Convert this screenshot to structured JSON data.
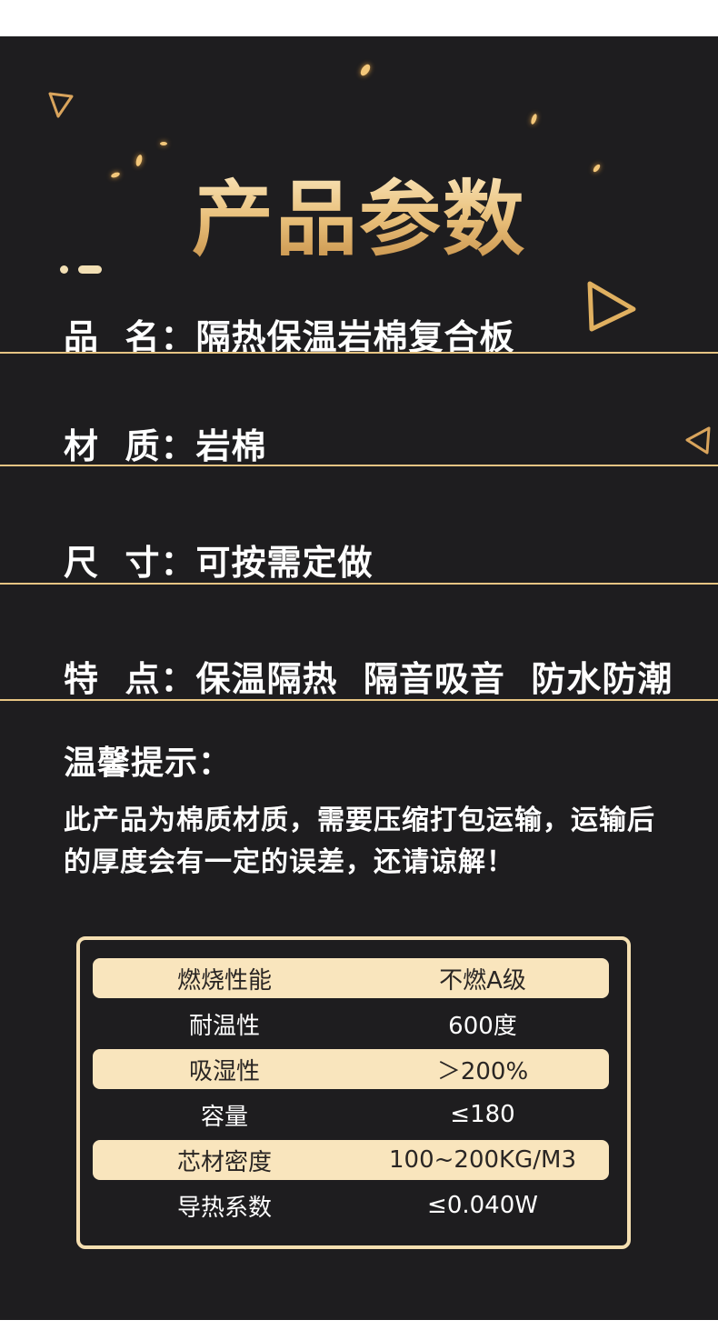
{
  "header": {
    "title": "产品参数"
  },
  "specs": [
    {
      "label": "品  名：",
      "value": "隔热保温岩棉复合板"
    },
    {
      "label": "材  质：",
      "value": "岩棉"
    },
    {
      "label": "尺  寸：",
      "value": "可按需定做"
    },
    {
      "label": "特  点：",
      "value": "保温隔热  隔音吸音  防水防潮"
    }
  ],
  "tip": {
    "heading": "温馨提示：",
    "body": "此产品为棉质材质，需要压缩打包运输，运输后的厚度会有一定的误差，还请谅解！"
  },
  "table": {
    "rows": [
      {
        "name": "燃烧性能",
        "value": "不燃A级"
      },
      {
        "name": "耐温性",
        "value": "600度"
      },
      {
        "name": "吸湿性",
        "value": "＞200%"
      },
      {
        "name": "容量",
        "value": "≤180"
      },
      {
        "name": "芯材密度",
        "value": "100~200KG/M3"
      },
      {
        "name": "导热系数",
        "value": "≤0.040W"
      }
    ]
  },
  "colors": {
    "background": "#1e1d1f",
    "gold": "#e6c483",
    "highlight_row": "#f9e5bd"
  },
  "decorations": [
    "triangle-outline-icon",
    "gold-spark-particles"
  ]
}
